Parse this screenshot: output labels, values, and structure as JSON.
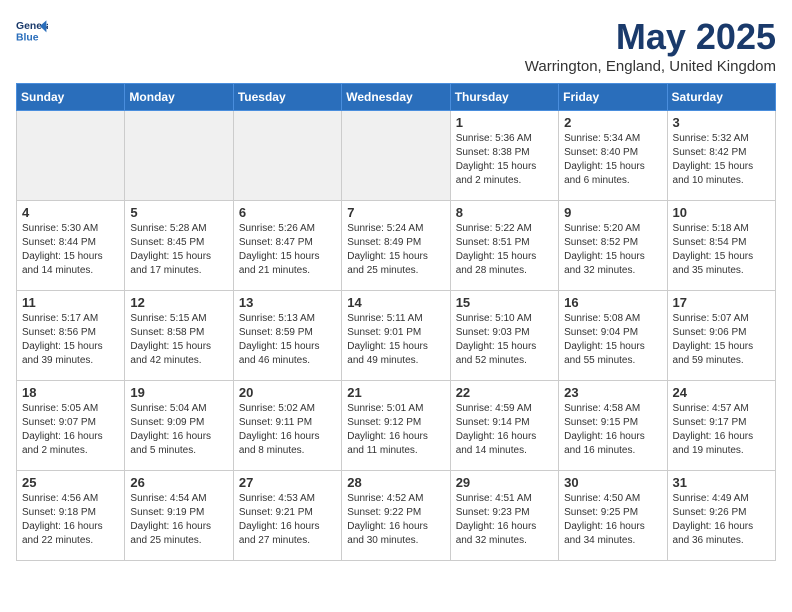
{
  "header": {
    "logo_line1": "General",
    "logo_line2": "Blue",
    "month_title": "May 2025",
    "location": "Warrington, England, United Kingdom"
  },
  "weekdays": [
    "Sunday",
    "Monday",
    "Tuesday",
    "Wednesday",
    "Thursday",
    "Friday",
    "Saturday"
  ],
  "weeks": [
    [
      {
        "day": "",
        "info": ""
      },
      {
        "day": "",
        "info": ""
      },
      {
        "day": "",
        "info": ""
      },
      {
        "day": "",
        "info": ""
      },
      {
        "day": "1",
        "info": "Sunrise: 5:36 AM\nSunset: 8:38 PM\nDaylight: 15 hours\nand 2 minutes."
      },
      {
        "day": "2",
        "info": "Sunrise: 5:34 AM\nSunset: 8:40 PM\nDaylight: 15 hours\nand 6 minutes."
      },
      {
        "day": "3",
        "info": "Sunrise: 5:32 AM\nSunset: 8:42 PM\nDaylight: 15 hours\nand 10 minutes."
      }
    ],
    [
      {
        "day": "4",
        "info": "Sunrise: 5:30 AM\nSunset: 8:44 PM\nDaylight: 15 hours\nand 14 minutes."
      },
      {
        "day": "5",
        "info": "Sunrise: 5:28 AM\nSunset: 8:45 PM\nDaylight: 15 hours\nand 17 minutes."
      },
      {
        "day": "6",
        "info": "Sunrise: 5:26 AM\nSunset: 8:47 PM\nDaylight: 15 hours\nand 21 minutes."
      },
      {
        "day": "7",
        "info": "Sunrise: 5:24 AM\nSunset: 8:49 PM\nDaylight: 15 hours\nand 25 minutes."
      },
      {
        "day": "8",
        "info": "Sunrise: 5:22 AM\nSunset: 8:51 PM\nDaylight: 15 hours\nand 28 minutes."
      },
      {
        "day": "9",
        "info": "Sunrise: 5:20 AM\nSunset: 8:52 PM\nDaylight: 15 hours\nand 32 minutes."
      },
      {
        "day": "10",
        "info": "Sunrise: 5:18 AM\nSunset: 8:54 PM\nDaylight: 15 hours\nand 35 minutes."
      }
    ],
    [
      {
        "day": "11",
        "info": "Sunrise: 5:17 AM\nSunset: 8:56 PM\nDaylight: 15 hours\nand 39 minutes."
      },
      {
        "day": "12",
        "info": "Sunrise: 5:15 AM\nSunset: 8:58 PM\nDaylight: 15 hours\nand 42 minutes."
      },
      {
        "day": "13",
        "info": "Sunrise: 5:13 AM\nSunset: 8:59 PM\nDaylight: 15 hours\nand 46 minutes."
      },
      {
        "day": "14",
        "info": "Sunrise: 5:11 AM\nSunset: 9:01 PM\nDaylight: 15 hours\nand 49 minutes."
      },
      {
        "day": "15",
        "info": "Sunrise: 5:10 AM\nSunset: 9:03 PM\nDaylight: 15 hours\nand 52 minutes."
      },
      {
        "day": "16",
        "info": "Sunrise: 5:08 AM\nSunset: 9:04 PM\nDaylight: 15 hours\nand 55 minutes."
      },
      {
        "day": "17",
        "info": "Sunrise: 5:07 AM\nSunset: 9:06 PM\nDaylight: 15 hours\nand 59 minutes."
      }
    ],
    [
      {
        "day": "18",
        "info": "Sunrise: 5:05 AM\nSunset: 9:07 PM\nDaylight: 16 hours\nand 2 minutes."
      },
      {
        "day": "19",
        "info": "Sunrise: 5:04 AM\nSunset: 9:09 PM\nDaylight: 16 hours\nand 5 minutes."
      },
      {
        "day": "20",
        "info": "Sunrise: 5:02 AM\nSunset: 9:11 PM\nDaylight: 16 hours\nand 8 minutes."
      },
      {
        "day": "21",
        "info": "Sunrise: 5:01 AM\nSunset: 9:12 PM\nDaylight: 16 hours\nand 11 minutes."
      },
      {
        "day": "22",
        "info": "Sunrise: 4:59 AM\nSunset: 9:14 PM\nDaylight: 16 hours\nand 14 minutes."
      },
      {
        "day": "23",
        "info": "Sunrise: 4:58 AM\nSunset: 9:15 PM\nDaylight: 16 hours\nand 16 minutes."
      },
      {
        "day": "24",
        "info": "Sunrise: 4:57 AM\nSunset: 9:17 PM\nDaylight: 16 hours\nand 19 minutes."
      }
    ],
    [
      {
        "day": "25",
        "info": "Sunrise: 4:56 AM\nSunset: 9:18 PM\nDaylight: 16 hours\nand 22 minutes."
      },
      {
        "day": "26",
        "info": "Sunrise: 4:54 AM\nSunset: 9:19 PM\nDaylight: 16 hours\nand 25 minutes."
      },
      {
        "day": "27",
        "info": "Sunrise: 4:53 AM\nSunset: 9:21 PM\nDaylight: 16 hours\nand 27 minutes."
      },
      {
        "day": "28",
        "info": "Sunrise: 4:52 AM\nSunset: 9:22 PM\nDaylight: 16 hours\nand 30 minutes."
      },
      {
        "day": "29",
        "info": "Sunrise: 4:51 AM\nSunset: 9:23 PM\nDaylight: 16 hours\nand 32 minutes."
      },
      {
        "day": "30",
        "info": "Sunrise: 4:50 AM\nSunset: 9:25 PM\nDaylight: 16 hours\nand 34 minutes."
      },
      {
        "day": "31",
        "info": "Sunrise: 4:49 AM\nSunset: 9:26 PM\nDaylight: 16 hours\nand 36 minutes."
      }
    ]
  ]
}
